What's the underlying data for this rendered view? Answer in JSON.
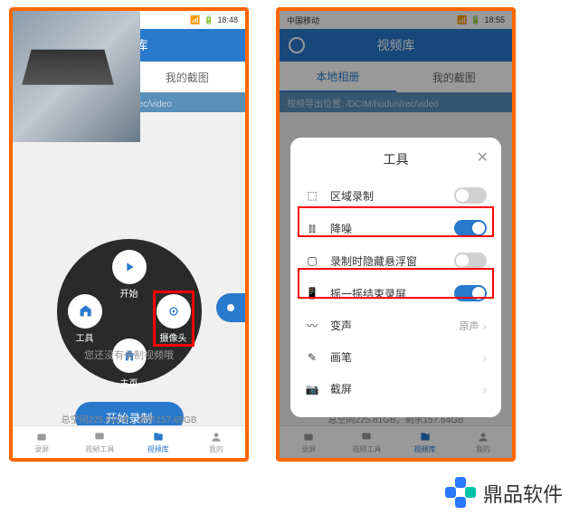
{
  "status": {
    "carrier": "中国移动",
    "signal": "⁴⁶",
    "time1": "18:48",
    "time2": "18:55",
    "battery": "95"
  },
  "header": {
    "title": "视频库"
  },
  "tabs": {
    "local": "本地相册",
    "screenshots": "我的截图"
  },
  "path": {
    "text": "视频导出位置: /DCIM/hudun/rec/video"
  },
  "radial": {
    "start": "开始",
    "tools": "工具",
    "camera": "摄像头",
    "home": "主页"
  },
  "hidden": {
    "text": "您还没有录制视频哦"
  },
  "startbtn": {
    "label": "开始录制"
  },
  "storage": {
    "text1": "总空间225.81GB，剩余157.65GB",
    "text2": "总空间225.81GB，剩余157.64GB"
  },
  "bottomnav": {
    "record": "录屏",
    "tools": "视频工具",
    "library": "视频库",
    "mine": "我的"
  },
  "modal": {
    "title": "工具",
    "rows": {
      "area": "区域录制",
      "noise": "降噪",
      "hide": "录制时隐藏悬浮窗",
      "shake": "摇一摇结束录屏",
      "voice": "变声",
      "voiceval": "原声",
      "brush": "画笔",
      "shot": "截屏"
    }
  },
  "brand": {
    "text": "鼎品软件"
  }
}
